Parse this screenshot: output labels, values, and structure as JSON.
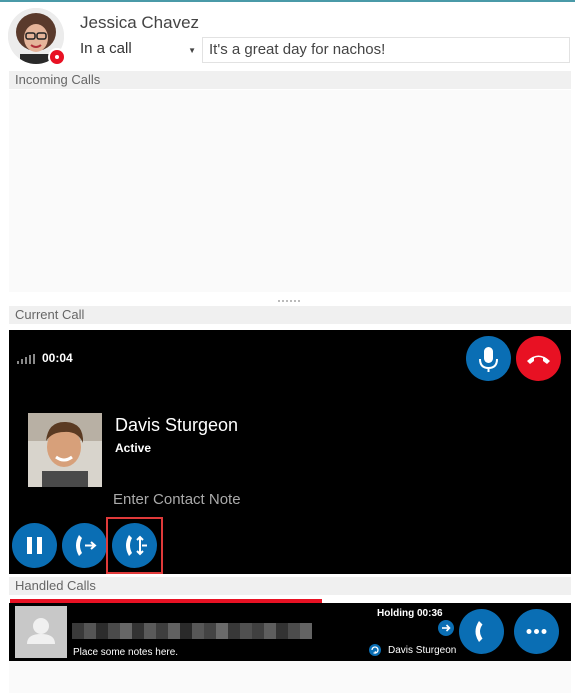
{
  "header": {
    "user_name": "Jessica Chavez",
    "status": "In a call",
    "status_message": "It's a great day for nachos!",
    "presence_color": "#e81123"
  },
  "sections": {
    "incoming": "Incoming Calls",
    "current": "Current Call",
    "handled": "Handled Calls"
  },
  "current_call": {
    "timer": "00:04",
    "contact_name": "Davis Sturgeon",
    "contact_state": "Active",
    "note_placeholder": "Enter Contact Note",
    "buttons": [
      "mute-icon",
      "hangup-icon",
      "hold-icon",
      "transfer-icon",
      "consult-icon"
    ]
  },
  "handled_calls": {
    "note_placeholder": "Place some notes here.",
    "holding_label": "Holding",
    "holding_time": "00:36",
    "holding_contact": "Davis Sturgeon",
    "progress": 0.55
  },
  "colors": {
    "accent_blue": "#0a6eb4",
    "hangup_red": "#e81123",
    "panel_black": "#000000"
  }
}
